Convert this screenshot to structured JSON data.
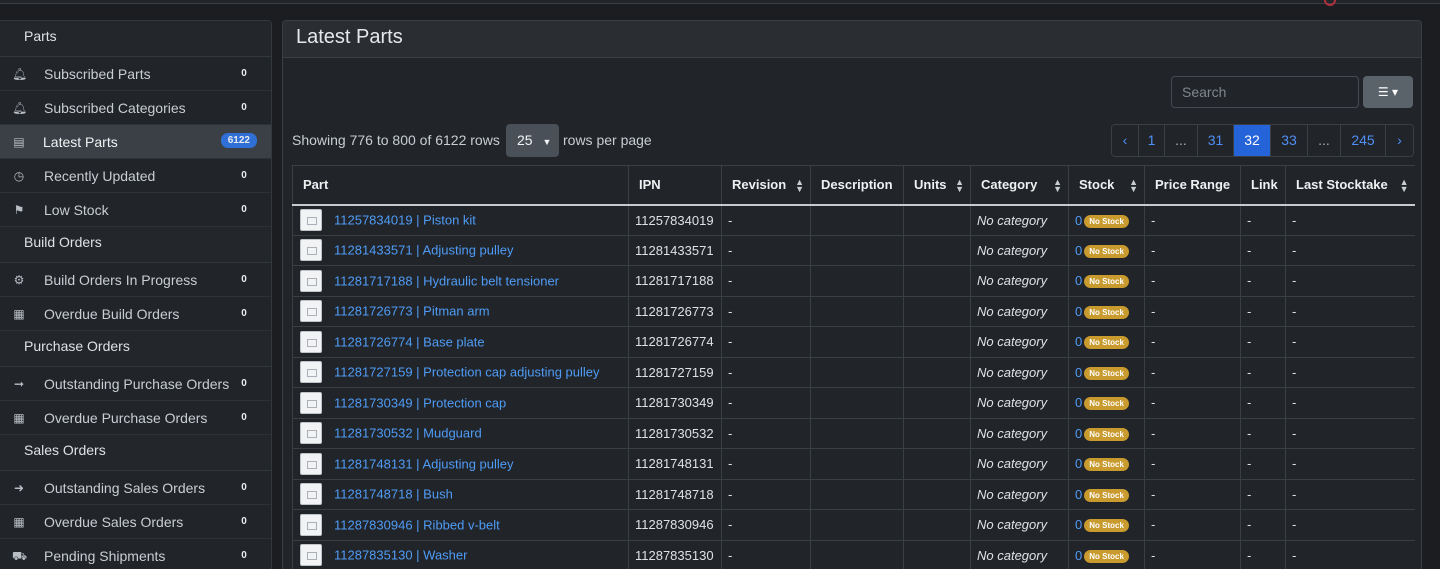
{
  "sidebar": {
    "sections": [
      {
        "title": "Parts"
      },
      {
        "title": "Build Orders"
      },
      {
        "title": "Purchase Orders"
      },
      {
        "title": "Sales Orders"
      }
    ],
    "items": [
      {
        "label": "Subscribed Parts",
        "count": "0",
        "icon": "bell-icon"
      },
      {
        "label": "Subscribed Categories",
        "count": "0",
        "icon": "bell-icon"
      },
      {
        "label": "Latest Parts",
        "count": "6122",
        "icon": "table-icon"
      },
      {
        "label": "Recently Updated",
        "count": "0",
        "icon": "clock-icon"
      },
      {
        "label": "Low Stock",
        "count": "0",
        "icon": "flag-icon"
      },
      {
        "label": "Build Orders In Progress",
        "count": "0",
        "icon": "gears-icon"
      },
      {
        "label": "Overdue Build Orders",
        "count": "0",
        "icon": "calendar-x-icon"
      },
      {
        "label": "Outstanding Purchase Orders",
        "count": "0",
        "icon": "sign-in-icon"
      },
      {
        "label": "Overdue Purchase Orders",
        "count": "0",
        "icon": "calendar-x-icon"
      },
      {
        "label": "Outstanding Sales Orders",
        "count": "0",
        "icon": "sign-out-icon"
      },
      {
        "label": "Overdue Sales Orders",
        "count": "0",
        "icon": "calendar-x-icon"
      },
      {
        "label": "Pending Shipments",
        "count": "0",
        "icon": "truck-icon"
      }
    ]
  },
  "main": {
    "title": "Latest Parts",
    "search_placeholder": "Search",
    "showing": "Showing 776 to 800 of 6122 rows",
    "rows_per_page": "25",
    "rows_per_page_label": "rows per page",
    "pagination": [
      "‹",
      "1",
      "...",
      "31",
      "32",
      "33",
      "...",
      "245",
      "›"
    ],
    "active_page": "32",
    "columns": [
      "Part",
      "IPN",
      "Revision",
      "Description",
      "Units",
      "Category",
      "Stock",
      "Price Range",
      "Link",
      "Last Stocktake"
    ],
    "rows": [
      {
        "part": "11257834019 | Piston kit",
        "ipn": "11257834019",
        "revision": "-",
        "description": "",
        "units": "",
        "category": "No category",
        "stock": "0",
        "stock_badge": "No Stock",
        "price": "-",
        "link": "-",
        "stocktake": "-"
      },
      {
        "part": "11281433571 | Adjusting pulley",
        "ipn": "11281433571",
        "revision": "-",
        "description": "",
        "units": "",
        "category": "No category",
        "stock": "0",
        "stock_badge": "No Stock",
        "price": "-",
        "link": "-",
        "stocktake": "-"
      },
      {
        "part": "11281717188 | Hydraulic belt tensioner",
        "ipn": "11281717188",
        "revision": "-",
        "description": "",
        "units": "",
        "category": "No category",
        "stock": "0",
        "stock_badge": "No Stock",
        "price": "-",
        "link": "-",
        "stocktake": "-"
      },
      {
        "part": "11281726773 | Pitman arm",
        "ipn": "11281726773",
        "revision": "-",
        "description": "",
        "units": "",
        "category": "No category",
        "stock": "0",
        "stock_badge": "No Stock",
        "price": "-",
        "link": "-",
        "stocktake": "-"
      },
      {
        "part": "11281726774 | Base plate",
        "ipn": "11281726774",
        "revision": "-",
        "description": "",
        "units": "",
        "category": "No category",
        "stock": "0",
        "stock_badge": "No Stock",
        "price": "-",
        "link": "-",
        "stocktake": "-"
      },
      {
        "part": "11281727159 | Protection cap adjusting pulley",
        "ipn": "11281727159",
        "revision": "-",
        "description": "",
        "units": "",
        "category": "No category",
        "stock": "0",
        "stock_badge": "No Stock",
        "price": "-",
        "link": "-",
        "stocktake": "-"
      },
      {
        "part": "11281730349 | Protection cap",
        "ipn": "11281730349",
        "revision": "-",
        "description": "",
        "units": "",
        "category": "No category",
        "stock": "0",
        "stock_badge": "No Stock",
        "price": "-",
        "link": "-",
        "stocktake": "-"
      },
      {
        "part": "11281730532 | Mudguard",
        "ipn": "11281730532",
        "revision": "-",
        "description": "",
        "units": "",
        "category": "No category",
        "stock": "0",
        "stock_badge": "No Stock",
        "price": "-",
        "link": "-",
        "stocktake": "-"
      },
      {
        "part": "11281748131 | Adjusting pulley",
        "ipn": "11281748131",
        "revision": "-",
        "description": "",
        "units": "",
        "category": "No category",
        "stock": "0",
        "stock_badge": "No Stock",
        "price": "-",
        "link": "-",
        "stocktake": "-"
      },
      {
        "part": "11281748718 | Bush",
        "ipn": "11281748718",
        "revision": "-",
        "description": "",
        "units": "",
        "category": "No category",
        "stock": "0",
        "stock_badge": "No Stock",
        "price": "-",
        "link": "-",
        "stocktake": "-"
      },
      {
        "part": "11287830946 | Ribbed v-belt",
        "ipn": "11287830946",
        "revision": "-",
        "description": "",
        "units": "",
        "category": "No category",
        "stock": "0",
        "stock_badge": "No Stock",
        "price": "-",
        "link": "-",
        "stocktake": "-"
      },
      {
        "part": "11287835130 | Washer",
        "ipn": "11287835130",
        "revision": "-",
        "description": "",
        "units": "",
        "category": "No category",
        "stock": "0",
        "stock_badge": "No Stock",
        "price": "-",
        "link": "-",
        "stocktake": "-"
      }
    ]
  },
  "colors": {
    "accent": "#2563d9",
    "link": "#4f9cf7",
    "badge_warning": "#c99a2e",
    "background": "#1b1d20"
  }
}
